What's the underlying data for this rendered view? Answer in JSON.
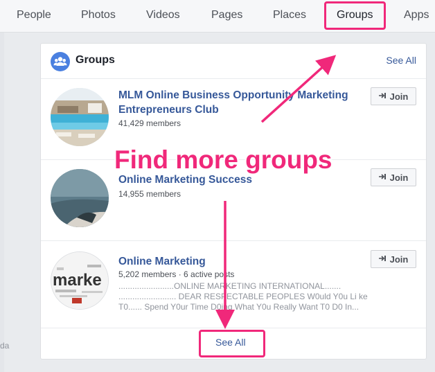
{
  "tabs": [
    "People",
    "Photos",
    "Videos",
    "Pages",
    "Places",
    "Groups",
    "Apps"
  ],
  "active_tab": "Groups",
  "left_fragment": "da",
  "card": {
    "title": "Groups",
    "see_all_top": "See All",
    "see_all_bottom": "See All"
  },
  "groups": [
    {
      "name": "MLM Online Business Opportunity Marketing Entrepreneurs Club",
      "members": "41,429 members",
      "join_label": "Join"
    },
    {
      "name": "Online Marketing Success",
      "members": "14,955 members",
      "join_label": "Join"
    },
    {
      "name": "Online Marketing",
      "members": "5,202 members · 6 active posts",
      "description": [
        "........................ONLINE MARKETING INTERNATIONAL.......",
        "......................... DEAR RESPECTABLE PEOPLES W0uld Y0u Li ke",
        "T0...... Spend Y0ur Time D0ing What Y0u Really Want T0 D0 In..."
      ],
      "thumb_text": "marke",
      "join_label": "Join"
    }
  ],
  "annotation": "Find more groups",
  "colors": {
    "highlight": "#f0287a",
    "link": "#365899",
    "icon_blue": "#4a80e0"
  },
  "icons": {
    "groups": "groups-people-icon",
    "join": "join-arrow-icon"
  }
}
